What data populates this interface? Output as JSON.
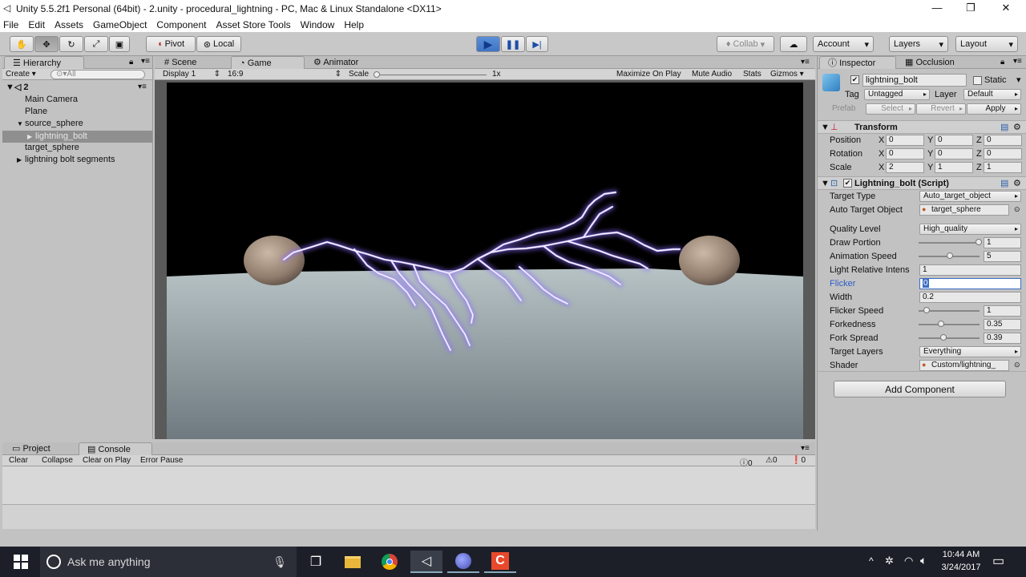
{
  "window": {
    "title": "Unity 5.5.2f1 Personal (64bit) - 2.unity - procedural_lightning - PC, Mac & Linux Standalone <DX11>",
    "minimize": "—",
    "restore": "❐",
    "close": "✕"
  },
  "menu": [
    "File",
    "Edit",
    "Assets",
    "GameObject",
    "Component",
    "Asset Store Tools",
    "Window",
    "Help"
  ],
  "toolbar": {
    "pivot": "Pivot",
    "local": "Local",
    "collab": "Collab",
    "account": "Account",
    "layers": "Layers",
    "layout": "Layout"
  },
  "hierarchy": {
    "tab": "Hierarchy",
    "create": "Create",
    "search_placeholder": "All",
    "scene": "2",
    "items": [
      {
        "label": "Main Camera",
        "indent": 1,
        "arrow": ""
      },
      {
        "label": "Plane",
        "indent": 1,
        "arrow": ""
      },
      {
        "label": "source_sphere",
        "indent": 1,
        "arrow": "▼"
      },
      {
        "label": "lightning_bolt",
        "indent": 2,
        "arrow": "▶",
        "selected": true
      },
      {
        "label": "target_sphere",
        "indent": 1,
        "arrow": ""
      },
      {
        "label": "lightning bolt segments",
        "indent": 1,
        "arrow": "▶"
      }
    ]
  },
  "center_tabs": {
    "scene": "Scene",
    "game": "Game",
    "animator": "Animator"
  },
  "game_bar": {
    "display": "Display 1",
    "aspect": "16:9",
    "scale_label": "Scale",
    "scale_value": "1x",
    "maximize": "Maximize On Play",
    "mute": "Mute Audio",
    "stats": "Stats",
    "gizmos": "Gizmos"
  },
  "console": {
    "tab_project": "Project",
    "tab_console": "Console",
    "clear": "Clear",
    "collapse": "Collapse",
    "clear_on_play": "Clear on Play",
    "error_pause": "Error Pause",
    "info_count": "0",
    "warn_count": "0",
    "error_count": "0"
  },
  "inspector": {
    "tab": "Inspector",
    "tab2": "Occlusion",
    "object_name": "lightning_bolt",
    "static_label": "Static",
    "tag_label": "Tag",
    "tag_value": "Untagged",
    "layer_label": "Layer",
    "layer_value": "Default",
    "prefab_label": "Prefab",
    "select": "Select",
    "revert": "Revert",
    "apply": "Apply",
    "transform": {
      "title": "Transform",
      "position": "Position",
      "rotation": "Rotation",
      "scale": "Scale",
      "pos": [
        "0",
        "0",
        "0"
      ],
      "rot": [
        "0",
        "0",
        "0"
      ],
      "scl": [
        "2",
        "1",
        "1"
      ]
    },
    "script": {
      "title": "Lightning_bolt (Script)",
      "rows": [
        {
          "label": "Target Type",
          "kind": "dd",
          "value": "Auto_target_object"
        },
        {
          "label": "Auto Target Object",
          "kind": "obj",
          "value": "target_sphere"
        },
        {
          "label": "Quality Level",
          "kind": "dd",
          "value": "High_quality"
        },
        {
          "label": "Draw Portion",
          "kind": "slider",
          "value": "1",
          "frac": 1.0
        },
        {
          "label": "Animation Speed",
          "kind": "slider",
          "value": "5",
          "frac": 0.5
        },
        {
          "label": "Light Relative Intens",
          "kind": "field",
          "value": "1"
        },
        {
          "label": "Flicker",
          "kind": "field",
          "value": "0",
          "focused": true
        },
        {
          "label": "Width",
          "kind": "field",
          "value": "0.2"
        },
        {
          "label": "Flicker Speed",
          "kind": "slider",
          "value": "1",
          "frac": 0.1
        },
        {
          "label": "Forkedness",
          "kind": "slider",
          "value": "0.35",
          "frac": 0.35
        },
        {
          "label": "Fork Spread",
          "kind": "slider",
          "value": "0.39",
          "frac": 0.39
        },
        {
          "label": "Target Layers",
          "kind": "dd",
          "value": "Everything"
        },
        {
          "label": "Shader",
          "kind": "obj",
          "value": "Custom/lightning_"
        }
      ]
    },
    "add_component": "Add Component"
  },
  "taskbar": {
    "search": "Ask me anything",
    "time": "10:44 AM",
    "date": "3/24/2017"
  },
  "colors": {
    "bolt": "#b9a6ff",
    "bolt_core": "#ffffff",
    "selection": "#3d6cc4"
  }
}
